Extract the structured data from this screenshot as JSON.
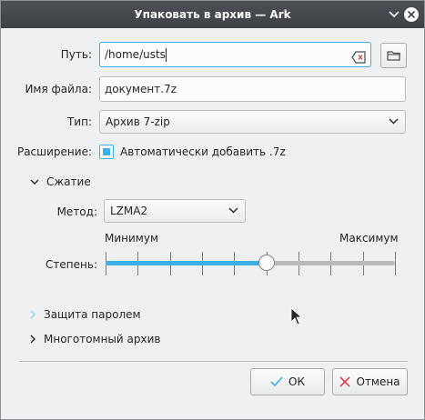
{
  "window": {
    "title": "Упаковать в архив — Ark",
    "minimize_icon": "chevron-down-icon",
    "close_icon": "close-icon"
  },
  "form": {
    "path": {
      "label": "Путь:",
      "value": "/home/usts"
    },
    "filename": {
      "label": "Имя файла:",
      "value": "документ.7z"
    },
    "type": {
      "label": "Тип:",
      "value": "Архив 7-zip"
    },
    "extension": {
      "label": "Расширение:",
      "checkbox_label": "Автоматически добавить .7z",
      "checked": true
    }
  },
  "compression": {
    "header": "Сжатие",
    "expanded": true,
    "method": {
      "label": "Метод:",
      "value": "LZMA2"
    },
    "level": {
      "label": "Степень:",
      "min_label": "Минимум",
      "max_label": "Максимум",
      "value": 5,
      "min": 0,
      "max": 9
    }
  },
  "sections": {
    "password": {
      "label": "Защита паролем",
      "expanded": false
    },
    "multivolume": {
      "label": "Многотомный архив",
      "expanded": false
    }
  },
  "buttons": {
    "ok": "ОК",
    "cancel": "Отмена"
  },
  "colors": {
    "accent": "#3daee9",
    "titlebar": "#45484d",
    "cancel_icon": "#da4453",
    "ok_icon": "#3daee9"
  }
}
